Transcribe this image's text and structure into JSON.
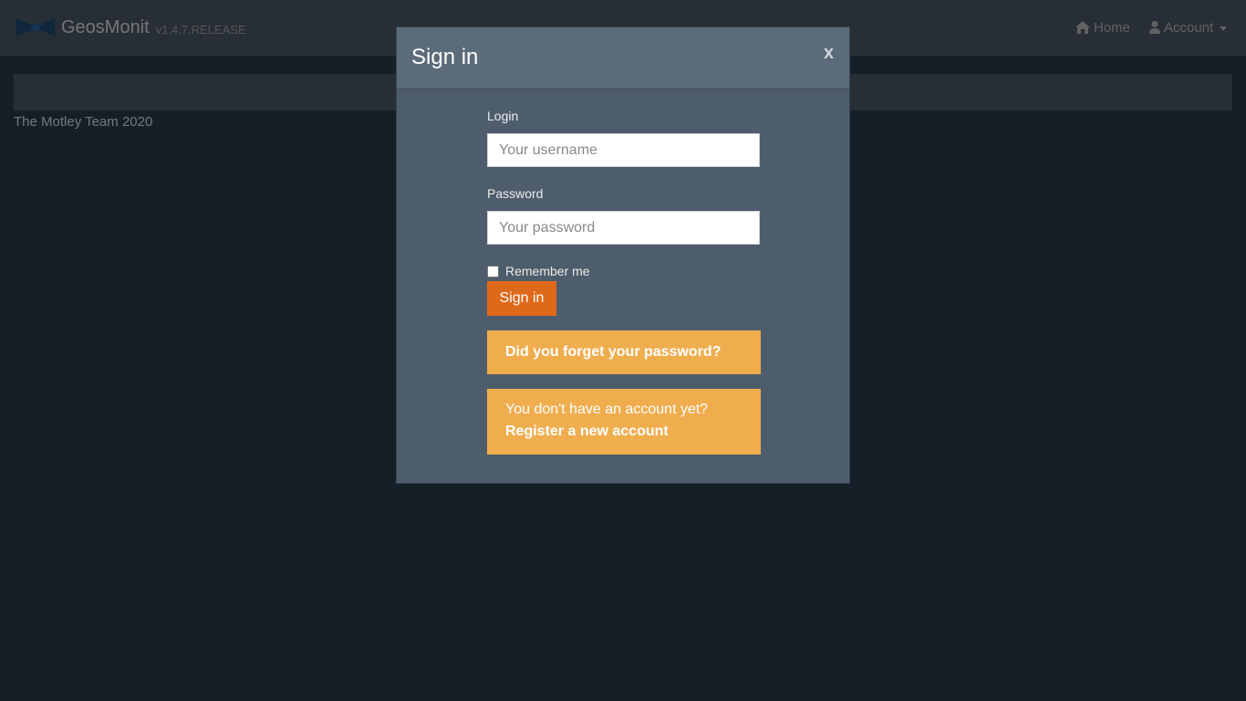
{
  "navbar": {
    "logo_icon": "bowtie-logo-icon",
    "brand_name": "GeosMonit",
    "version": "v1.4.7.RELEASE",
    "home_label": "Home",
    "home_icon": "home-icon",
    "account_label": "Account",
    "account_icon": "user-icon"
  },
  "content": {
    "footer_text": "The Motley Team 2020"
  },
  "modal": {
    "title": "Sign in",
    "close_label": "x",
    "login_label": "Login",
    "login_placeholder": "Your username",
    "login_value": "",
    "password_label": "Password",
    "password_placeholder": "Your password",
    "password_value": "",
    "remember_label": "Remember me",
    "remember_checked": false,
    "signin_button": "Sign in",
    "forgot_password_link": "Did you forget your password?",
    "no_account_text": "You don't have an account yet?",
    "register_link": "Register a new account"
  },
  "colors": {
    "body_bg": "#2b3e50",
    "navbar_bg": "#4e5d6c",
    "primary_button": "#df691a",
    "warning_alert": "#f0ad4e"
  }
}
